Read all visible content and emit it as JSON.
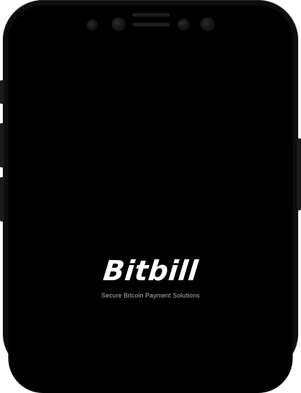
{
  "splash": {
    "logo_text": "Bitbill",
    "tagline": "Secure Bitcoin Payment Solutions"
  },
  "device": {
    "frame_color": "#0d0d0d",
    "screen_color": "#000000",
    "text_color": "#ffffff",
    "tagline_color": "#b8b8b8"
  }
}
